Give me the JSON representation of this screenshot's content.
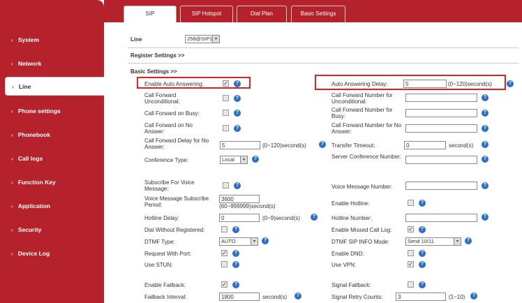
{
  "sidebar": {
    "items": [
      {
        "label": "System"
      },
      {
        "label": "Network"
      },
      {
        "label": "Line"
      },
      {
        "label": "Phone settings"
      },
      {
        "label": "Phonebook"
      },
      {
        "label": "Call logs"
      },
      {
        "label": "Function Key"
      },
      {
        "label": "Application"
      },
      {
        "label": "Security"
      },
      {
        "label": "Device Log"
      }
    ],
    "chevron": "›"
  },
  "tabs": [
    {
      "label": "SIP"
    },
    {
      "label": "SIP Hotspot"
    },
    {
      "label": "Dial Plan"
    },
    {
      "label": "Basic Settings"
    }
  ],
  "line": {
    "label": "Line",
    "value": "258@SIP1"
  },
  "sections": {
    "register": "Register Settings >>",
    "basic": "Basic Settings >>"
  },
  "colors": {
    "brand": "#b5222b",
    "help": "#2c6fc4",
    "highlight": "#e02020"
  },
  "fields": {
    "enable_auto_answering": {
      "label": "Enable Auto Answering:",
      "checked": true
    },
    "auto_answering_delay": {
      "label": "Auto Answering Delay:",
      "value": "5",
      "suffix": "(0~120)second(s)"
    },
    "cf_unconditional": {
      "label": "Call Forward Unconditional:",
      "checked": false
    },
    "cf_number_unconditional": {
      "label": "Call Forward Number for Unconditional:",
      "value": ""
    },
    "cf_busy": {
      "label": "Call Forward on Busy:",
      "checked": false
    },
    "cf_number_busy": {
      "label": "Call Forward Number for Busy:",
      "value": ""
    },
    "cf_no_answer": {
      "label": "Call Forward on No Answer:",
      "checked": false
    },
    "cf_number_no_answer": {
      "label": "Call Forward Number for No Answer:",
      "value": ""
    },
    "cf_delay": {
      "label": "Call Forward Delay for No Answer:",
      "value": "5",
      "suffix": "(0~120)second(s)"
    },
    "transfer_timeout": {
      "label": "Transfer Timeout:",
      "value": "0",
      "suffix": "second(s)"
    },
    "conference_type": {
      "label": "Conference Type:",
      "value": "Local"
    },
    "server_conference": {
      "label": "Server Conference Number:",
      "value": ""
    },
    "subscribe_vm": {
      "label": "Subscribe For Voice Message:",
      "checked": false
    },
    "vm_number": {
      "label": "Voice Message Number:",
      "value": ""
    },
    "vm_period": {
      "label": "Voice Message Subscribe Period:",
      "value": "3600",
      "suffix": "(60~999999)second(s)"
    },
    "enable_hotline": {
      "label": "Enable Hotline:",
      "checked": false
    },
    "hotline_delay": {
      "label": "Hotline Delay:",
      "value": "0",
      "suffix": "(0~9)second(s)"
    },
    "hotline_number": {
      "label": "Hotline Number:",
      "value": ""
    },
    "dial_without_reg": {
      "label": "Dial Without Registered:",
      "checked": false
    },
    "missed_call_log": {
      "label": "Enable Missed Call Log:",
      "checked": true
    },
    "dtmf_type": {
      "label": "DTMF Type:",
      "value": "AUTO"
    },
    "dtmf_sip_info": {
      "label": "DTMF SIP INFO Mode:",
      "value": "Send 10/11"
    },
    "request_with_port": {
      "label": "Request With Port:",
      "checked": true
    },
    "enable_dnd": {
      "label": "Enable DND:",
      "checked": false
    },
    "use_stun": {
      "label": "Use STUN:",
      "checked": false
    },
    "use_vpn": {
      "label": "Use VPN:",
      "checked": true
    },
    "enable_failback": {
      "label": "Enable Failback:",
      "checked": true
    },
    "signal_failback": {
      "label": "Signal Failback:",
      "checked": false
    },
    "failback_interval": {
      "label": "Failback Interval:",
      "value": "1800",
      "suffix": "second(s)"
    },
    "signal_retry": {
      "label": "Signal Retry Counts:",
      "value": "3",
      "suffix": "(1~10)"
    }
  },
  "icons": {
    "help": "?",
    "check": "✓",
    "dropdown": "▾"
  }
}
